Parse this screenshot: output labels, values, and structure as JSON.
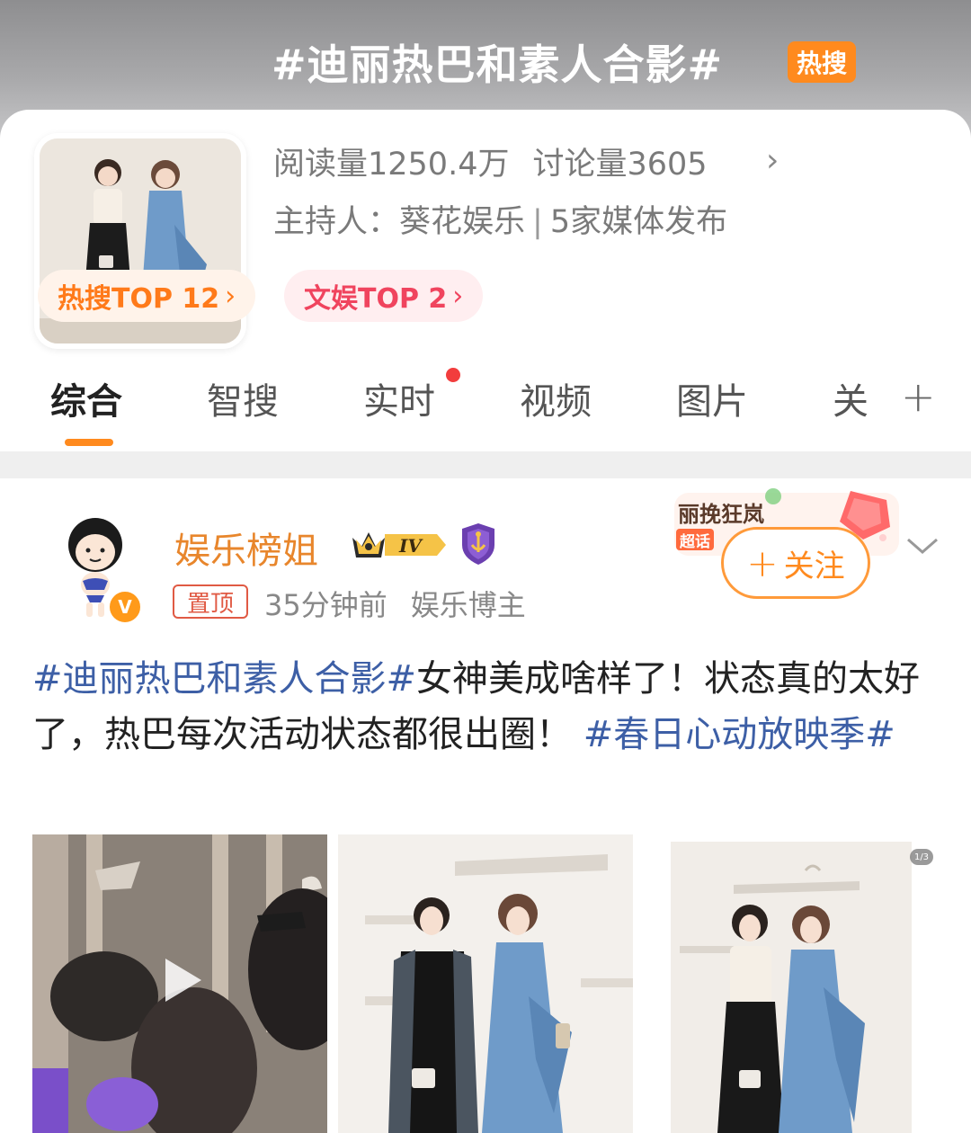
{
  "topic": {
    "title": "#迪丽热巴和素人合影#",
    "hot_badge": "热搜",
    "read_count": "阅读量1250.4万",
    "discuss_count": "讨论量3605",
    "host_line": "主持人：葵花娱乐",
    "media_line": "5家媒体发布",
    "rank_hot": "热搜TOP 12",
    "rank_ent": "文娱TOP 2"
  },
  "tabs": [
    {
      "label": "综合",
      "active": true
    },
    {
      "label": "智搜"
    },
    {
      "label": "实时",
      "has_dot": true
    },
    {
      "label": "视频"
    },
    {
      "label": "图片"
    },
    {
      "label": "关"
    }
  ],
  "post": {
    "author": "娱乐榜姐",
    "level_badge": "IV",
    "verified_mark": "V",
    "pinned_label": "置顶",
    "time": "35分钟前",
    "role": "娱乐博主",
    "super_topic_name": "丽挽狂岚",
    "super_topic_tag": "超话",
    "follow_label": "关注",
    "text_tag1": "#迪丽热巴和素人合影#",
    "text_body": "女神美成啥样了！状态真的太好了，热巴每次活动状态都很出圈！",
    "text_tag2": "#春日心动放映季#",
    "image_count": "1/3"
  },
  "colors": {
    "accent_orange": "#ff8a1e",
    "hashtag_blue": "#3d5fa6",
    "author_orange": "#e8862c",
    "rank_red": "#f0445e"
  }
}
